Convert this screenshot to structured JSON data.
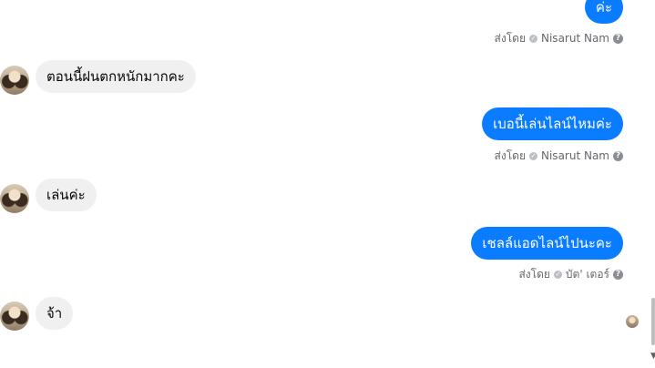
{
  "messages": [
    {
      "id": "m1",
      "direction": "out",
      "text": "ค่ะ",
      "sent_by_label": "ส่งโดย",
      "sender": "Nisarut Nam"
    },
    {
      "id": "m2",
      "direction": "in",
      "text": "ตอนนี้ฝนตกหนักมากคะ"
    },
    {
      "id": "m3",
      "direction": "out",
      "text": "เบอนี้เล่นไลน์ไหมค่ะ",
      "sent_by_label": "ส่งโดย",
      "sender": "Nisarut Nam"
    },
    {
      "id": "m4",
      "direction": "in",
      "text": "เล่นค่ะ"
    },
    {
      "id": "m5",
      "direction": "out",
      "text": "เชลล์แอดไลน์ไปนะคะ",
      "sent_by_label": "ส่งโดย",
      "sender": "บัต' เตอร์"
    },
    {
      "id": "m6",
      "direction": "in",
      "text": "จ้า"
    }
  ],
  "icons": {
    "check": "check-circle-icon",
    "help": "question-circle-icon"
  },
  "colors": {
    "outgoing_bubble": "#0a7cff",
    "incoming_bubble": "#f0f0f0",
    "meta_text": "#65676b"
  }
}
